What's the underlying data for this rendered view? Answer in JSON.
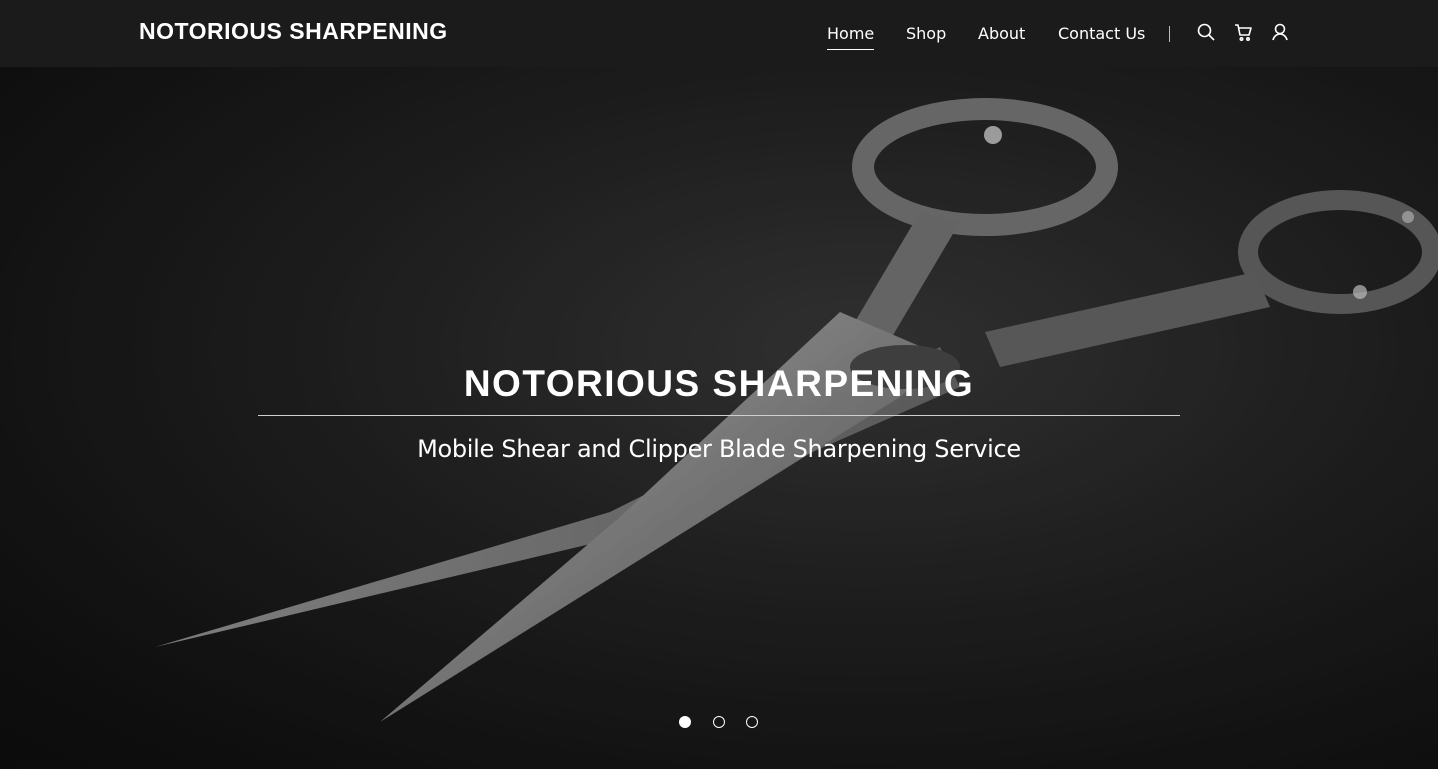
{
  "header": {
    "brand": "NOTORIOUS SHARPENING",
    "nav": [
      {
        "label": "Home",
        "active": true
      },
      {
        "label": "Shop",
        "active": false
      },
      {
        "label": "About",
        "active": false
      },
      {
        "label": "Contact Us",
        "active": false
      }
    ],
    "icons": [
      "search-icon",
      "cart-icon",
      "account-icon"
    ]
  },
  "hero": {
    "title": "NOTORIOUS SHARPENING",
    "subtitle": "Mobile Shear and Clipper Blade Sharpening Service",
    "image": "scissors-photo",
    "slides": {
      "count": 3,
      "active": 1
    }
  },
  "colors": {
    "header_bg": "#1b1b1b",
    "text": "#ffffff"
  }
}
